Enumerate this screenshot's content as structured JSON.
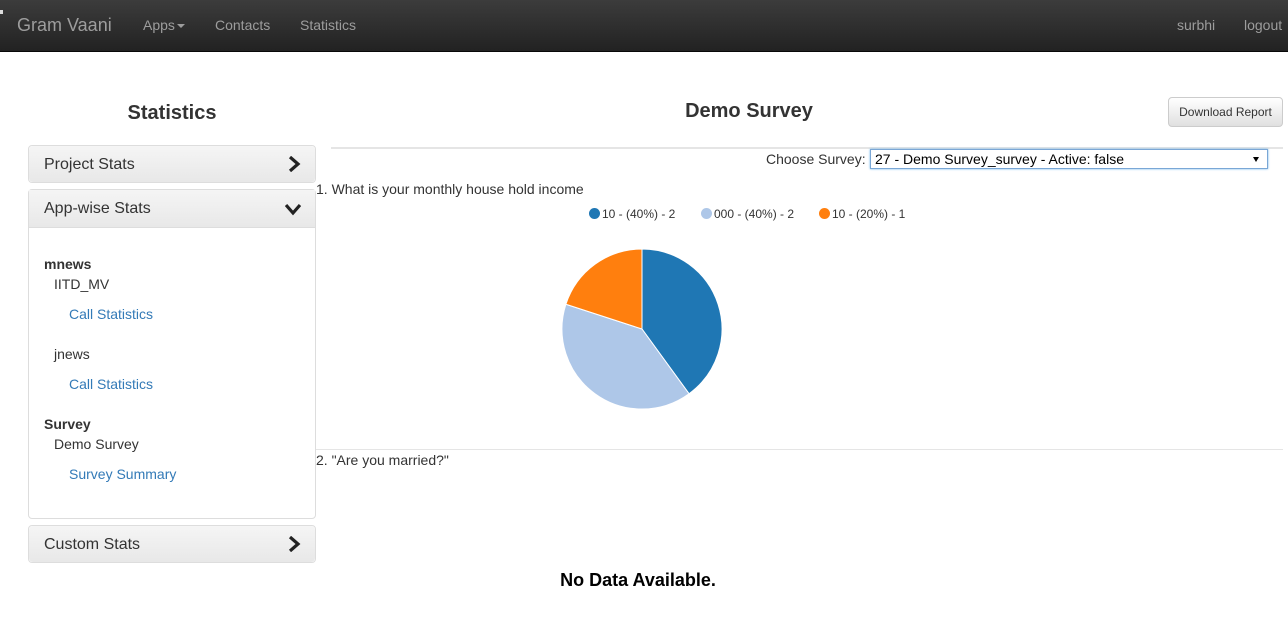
{
  "navbar": {
    "brand": "Gram Vaani",
    "items": [
      "Apps",
      "Contacts",
      "Statistics"
    ],
    "user": "surbhi",
    "logout": "logout"
  },
  "sidebar": {
    "title": "Statistics",
    "panels": [
      {
        "label": "Project Stats",
        "state": "collapsed"
      },
      {
        "label": "App-wise Stats",
        "state": "expanded"
      },
      {
        "label": "Custom Stats",
        "state": "collapsed"
      }
    ],
    "groups": [
      {
        "name": "mnews",
        "apps": [
          {
            "name": "IITD_MV",
            "link": "Call Statistics"
          },
          {
            "name": "jnews",
            "link": "Call Statistics"
          }
        ]
      },
      {
        "name": "Survey",
        "apps": [
          {
            "name": "Demo Survey",
            "link": "Survey Summary"
          }
        ]
      }
    ]
  },
  "main": {
    "title": "Demo Survey",
    "download_label": "Download Report",
    "choose_label": "Choose Survey:",
    "survey_selected": "27 - Demo Survey_survey - Active: false",
    "questions": [
      "1. What is your monthly house hold income",
      "2. \"Are you married?\""
    ],
    "no_data": "No Data Available."
  },
  "chart_data": {
    "type": "pie",
    "categories": [
      "10 - (40%) - 2",
      "000 - (40%) - 2",
      "10 - (20%) - 1"
    ],
    "values": [
      2,
      2,
      1
    ],
    "colors": [
      "#1f77b4",
      "#aec7e8",
      "#ff7f0e"
    ],
    "legend_position": "top"
  }
}
